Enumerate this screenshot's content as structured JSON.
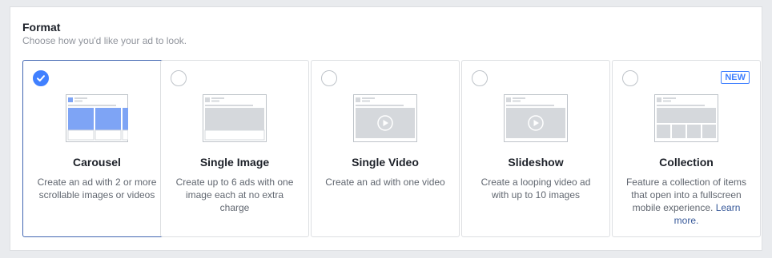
{
  "section": {
    "title": "Format",
    "subtitle": "Choose how you'd like your ad to look."
  },
  "colors": {
    "accent": "#4080ff",
    "selected_border": "#4267b2",
    "carousel_fill": "#7ea4f5",
    "placeholder_fill": "#d5d8dc",
    "link": "#365899"
  },
  "formats": [
    {
      "name": "Carousel",
      "description": "Create an ad with 2 or more scrollable images or videos",
      "selected": true,
      "icon": "carousel-preview-icon"
    },
    {
      "name": "Single Image",
      "description": "Create up to 6 ads with one image each at no extra charge",
      "selected": false,
      "icon": "single-image-preview-icon"
    },
    {
      "name": "Single Video",
      "description": "Create an ad with one video",
      "selected": false,
      "icon": "single-video-preview-icon"
    },
    {
      "name": "Slideshow",
      "description": "Create a looping video ad with up to 10 images",
      "selected": false,
      "icon": "slideshow-preview-icon"
    },
    {
      "name": "Collection",
      "description": "Feature a collection of items that open into a fullscreen mobile experience.",
      "link_text": "Learn more.",
      "badge": "NEW",
      "selected": false,
      "icon": "collection-preview-icon"
    }
  ]
}
